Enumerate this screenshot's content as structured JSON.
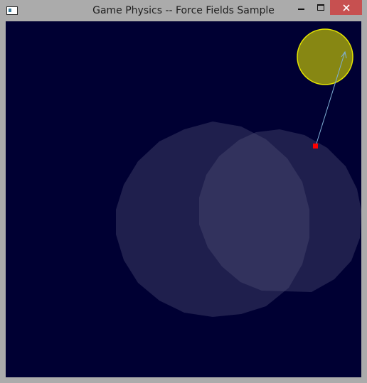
{
  "window": {
    "title": "Game Physics -- Force Fields Sample",
    "icons": {
      "app": "app-window-icon",
      "minimize": "minimize-icon",
      "maximize": "maximize-icon",
      "close": "close-icon"
    }
  },
  "scene": {
    "background_color": "#000033",
    "force_field_color": "#52527a",
    "force_field_opacity": 0.38,
    "target_fill": "#878713",
    "target_stroke": "#e5e500",
    "particle_color": "#ff0000",
    "vector_color": "#7fb0d6"
  }
}
